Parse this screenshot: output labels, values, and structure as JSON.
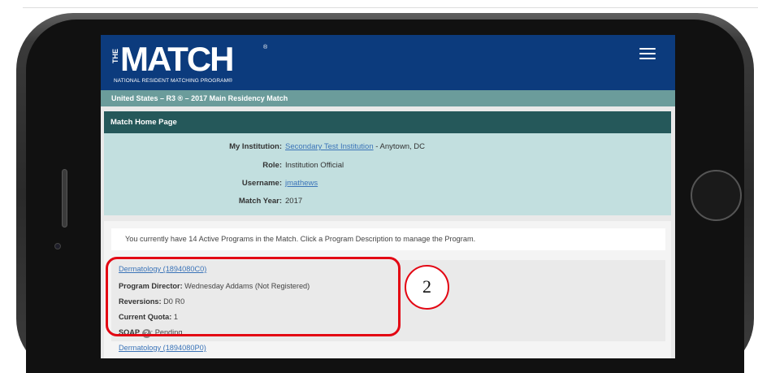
{
  "header": {
    "logo_the": "THE",
    "logo_match": "MATCH",
    "logo_tm": "®",
    "logo_subtitle": "NATIONAL RESIDENT MATCHING PROGRAM®",
    "menu_icon": "hamburger-menu-icon"
  },
  "breadcrumb": "United States  –  R3 ®  –  2017 Main Residency Match",
  "home_panel": {
    "title": "Match Home Page",
    "rows": [
      {
        "label": "My Institution:",
        "link": "Secondary Test Institution",
        "suffix": " - Anytown, DC"
      },
      {
        "label": "Role:",
        "value": "Institution Official"
      },
      {
        "label": "Username:",
        "link": "jmathews"
      },
      {
        "label": "Match Year:",
        "value": "2017"
      }
    ]
  },
  "notice": "You currently have 14 Active Programs in the Match. Click a Program Description to manage the Program.",
  "programs": [
    {
      "name": "Dermatology (1894080C0)",
      "director_label": "Program Director:",
      "director": " Wednesday Addams (Not Registered)",
      "reversions_label": "Reversions:",
      "reversions": " D0 R0",
      "quota_label": "Current Quota:",
      "quota": " 1",
      "soap_label": "SOAP",
      "soap_icon": "help-icon",
      "soap": ": Pending"
    },
    {
      "name": "Dermatology (1894080P0)"
    }
  ],
  "callout": {
    "number": "2",
    "color": "#e30613"
  },
  "colors": {
    "header": "#0c3b7d",
    "breadcrumb": "#6b9c9b",
    "panel_title": "#25585a",
    "panel_bg": "#c2dfdf",
    "link": "#3b74b8"
  }
}
